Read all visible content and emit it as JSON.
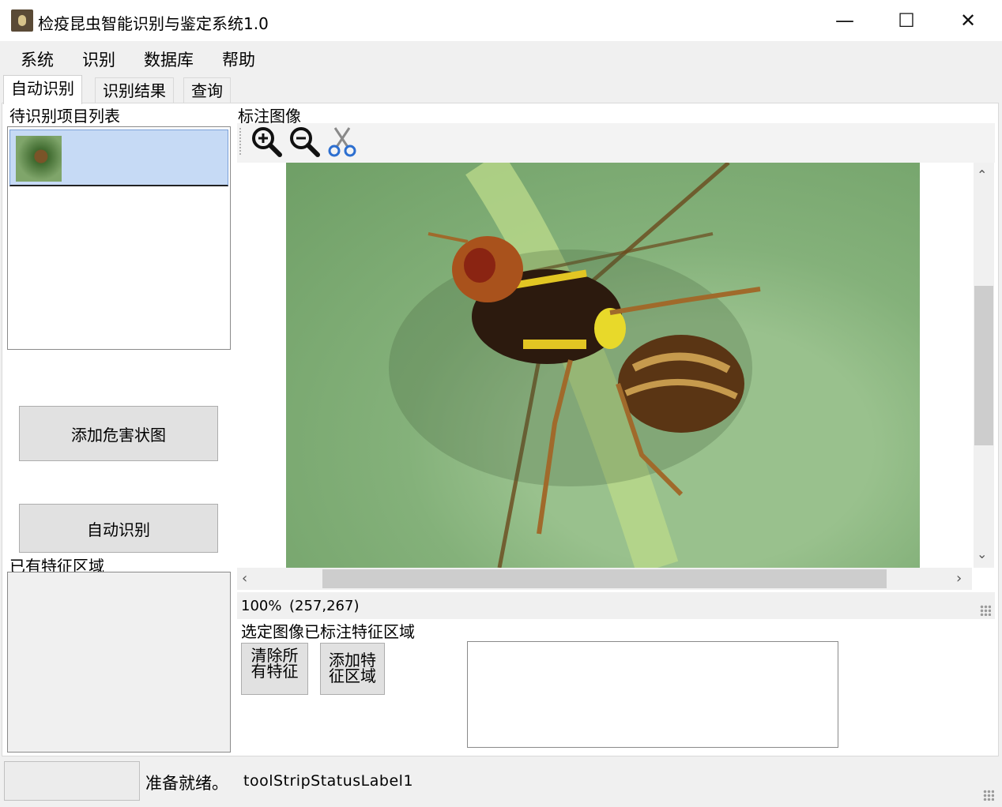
{
  "window": {
    "title": "检疫昆虫智能识别与鉴定系统1.0",
    "controls": {
      "minimize": "—",
      "maximize": "☐",
      "close": "✕"
    }
  },
  "menu": {
    "items": [
      "系统",
      "识别",
      "数据库",
      "帮助"
    ]
  },
  "tabs": [
    {
      "label": "自动识别",
      "active": true
    },
    {
      "label": "识别结果",
      "active": false
    },
    {
      "label": "查询",
      "active": false
    }
  ],
  "left": {
    "list_title": "待识别项目列表",
    "add_button": "添加危害状图",
    "auto_button": "自动识别",
    "feature_title": "已有特征区域"
  },
  "annotation": {
    "title": "标注图像",
    "tools": [
      {
        "icon": "zoom-in-icon",
        "glyph": "⊕"
      },
      {
        "icon": "zoom-out-icon",
        "glyph": "⊖"
      },
      {
        "icon": "scissors-icon",
        "glyph": "✂"
      }
    ],
    "zoom_level": "100%",
    "coords": "(257,267)",
    "selected_title": "选定图像已标注特征区域",
    "clear_button": "清除所有特征",
    "add_region_button": "添加特征区域"
  },
  "status": {
    "ready": "准备就绪。",
    "label1": "toolStripStatusLabel1"
  },
  "colors": {
    "accent_selection": "#c6daf5",
    "scrollbar_thumb": "#cdcdcd"
  }
}
